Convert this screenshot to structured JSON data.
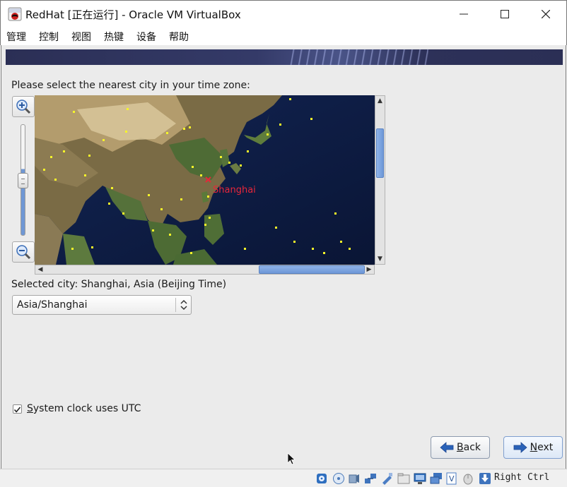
{
  "window": {
    "title": "RedHat [正在运行] - Oracle VM VirtualBox",
    "app_icon": "virtualbox-redhat-icon",
    "controls": [
      "minimize-icon",
      "maximize-icon",
      "close-icon"
    ]
  },
  "menu": {
    "items": [
      "管理",
      "控制",
      "视图",
      "热键",
      "设备",
      "帮助"
    ]
  },
  "installer": {
    "prompt": "Please select the nearest city in your time zone:",
    "map": {
      "selected_city_label": "Shanghai",
      "marker_color": "#e8263a",
      "city_dot_color": "#f5f52a"
    },
    "zoom": {
      "in_icon": "zoom-in-icon",
      "out_icon": "zoom-out-icon",
      "level_fraction": 0.62
    },
    "selected_city_text": "Selected city: Shanghai, Asia (Beijing Time)",
    "timezone_select": {
      "value": "Asia/Shanghai"
    },
    "utc_checkbox": {
      "label_prefix": "S",
      "label_rest": "ystem clock uses UTC",
      "checked": true
    },
    "buttons": {
      "back": {
        "prefix": "B",
        "rest": "ack",
        "icon": "arrow-left-icon"
      },
      "next": {
        "prefix": "N",
        "rest": "ext",
        "icon": "arrow-right-icon"
      }
    }
  },
  "statusbar": {
    "icons": [
      "hard-disk-icon",
      "optical-drive-icon",
      "audio-icon",
      "network-icon",
      "usb-icon",
      "shared-folder-icon",
      "display-icon",
      "video-capture-icon",
      "virtualization-icon",
      "mouse-integration-icon",
      "host-key-arrow-icon"
    ],
    "host_key": "Right Ctrl"
  },
  "colors": {
    "banner": "#2b2f55",
    "accent_blue": "#6d97d7",
    "window_bg": "#ebebeb"
  }
}
